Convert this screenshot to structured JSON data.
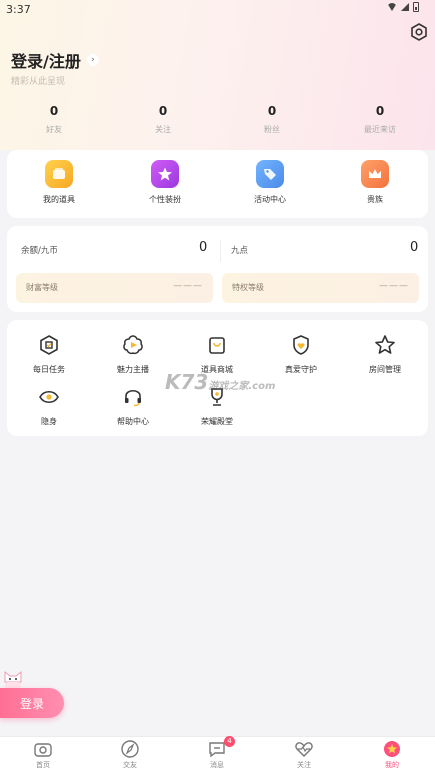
{
  "status_bar": {
    "time": "3:37"
  },
  "header": {
    "title": "登录/注册",
    "subtitle": "精彩从此呈现"
  },
  "stats": [
    {
      "value": "0",
      "label": "好友"
    },
    {
      "value": "0",
      "label": "关注"
    },
    {
      "value": "0",
      "label": "粉丝"
    },
    {
      "value": "0",
      "label": "最近来访"
    }
  ],
  "quick_actions": [
    {
      "label": "我的道具",
      "icon": "props-box-icon",
      "color": "#f7b731"
    },
    {
      "label": "个性装扮",
      "icon": "star-badge-icon",
      "color": "#b046e8"
    },
    {
      "label": "活动中心",
      "icon": "tag-icon",
      "color": "#5b9cf5"
    },
    {
      "label": "贵族",
      "icon": "crown-icon",
      "color": "#f4874b"
    }
  ],
  "balance": {
    "left_label": "余额/九币",
    "left_value": "0",
    "right_label": "九点",
    "right_value": "0",
    "wealth_label": "财富等级",
    "wealth_value": "———",
    "privilege_label": "特权等级",
    "privilege_value": "———"
  },
  "services": [
    {
      "label": "每日任务",
      "icon": "task-shield-icon"
    },
    {
      "label": "魅力主播",
      "icon": "flower-play-icon"
    },
    {
      "label": "道具商城",
      "icon": "shop-bag-icon"
    },
    {
      "label": "真爱守护",
      "icon": "heart-shield-icon"
    },
    {
      "label": "房间管理",
      "icon": "star-outline-icon"
    },
    {
      "label": "隐身",
      "icon": "eye-icon"
    },
    {
      "label": "帮助中心",
      "icon": "headset-icon"
    },
    {
      "label": "荣耀殿堂",
      "icon": "trophy-icon"
    }
  ],
  "watermark": {
    "main": "K73",
    "sub": "游戏之家",
    "domain": ".com"
  },
  "floating_login": "登录",
  "tabbar": [
    {
      "label": "首页",
      "icon": "camera-icon",
      "badge": ""
    },
    {
      "label": "交友",
      "icon": "compass-icon",
      "badge": ""
    },
    {
      "label": "消息",
      "icon": "message-icon",
      "badge": "4"
    },
    {
      "label": "关注",
      "icon": "heartbeat-icon",
      "badge": ""
    },
    {
      "label": "我的",
      "icon": "profile-icon",
      "badge": ""
    }
  ],
  "colors": {
    "accent": "#ff4f7b",
    "gold": "#f7b731"
  }
}
